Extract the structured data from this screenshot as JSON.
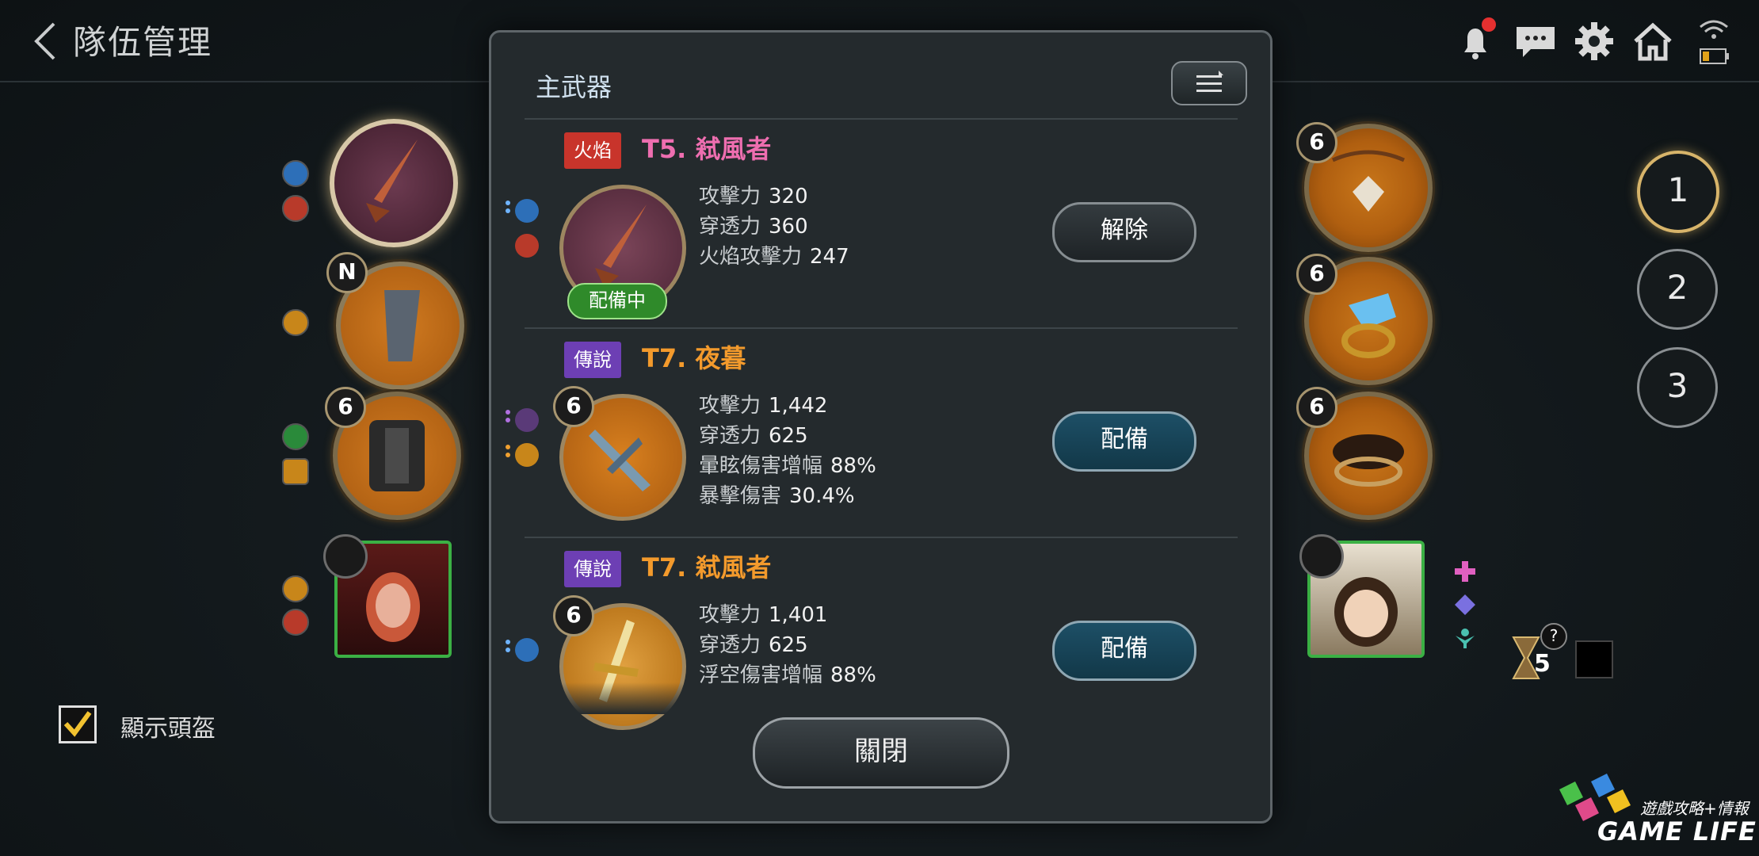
{
  "header": {
    "title": "隊伍管理",
    "icons": [
      "back-arrow-icon",
      "bell-icon",
      "chat-icon",
      "gear-icon",
      "home-icon",
      "wifi-icon",
      "battery-icon"
    ]
  },
  "team": {
    "left_gear_levels": [
      "N",
      "6"
    ],
    "right_gear_levels": [
      "6",
      "6",
      "6"
    ],
    "page_buttons": [
      "1",
      "2",
      "3"
    ],
    "active_page": "1"
  },
  "helmet_toggle": {
    "label": "顯示頭盔",
    "checked": true
  },
  "hourglass_count": "5",
  "modal": {
    "title": "主武器",
    "items": [
      {
        "tag": "火焰",
        "name": "T5. 弒風者",
        "level": "",
        "badge": "配備中",
        "stats": [
          {
            "label": "攻擊力",
            "value": "320"
          },
          {
            "label": "穿透力",
            "value": "360"
          },
          {
            "label": "火焰攻擊力",
            "value": "247"
          }
        ],
        "action": "解除"
      },
      {
        "tag": "傳說",
        "name": "T7. 夜暮",
        "level": "6",
        "stats": [
          {
            "label": "攻擊力",
            "value": "1,442"
          },
          {
            "label": "穿透力",
            "value": "625"
          },
          {
            "label": "暈眩傷害增幅",
            "value": "88%"
          },
          {
            "label": "暴擊傷害",
            "value": "30.4%"
          }
        ],
        "action": "配備"
      },
      {
        "tag": "傳說",
        "name": "T7. 弒風者",
        "level": "6",
        "stats": [
          {
            "label": "攻擊力",
            "value": "1,401"
          },
          {
            "label": "穿透力",
            "value": "625"
          },
          {
            "label": "浮空傷害增幅",
            "value": "88%"
          }
        ],
        "action": "配備"
      }
    ],
    "close_label": "關閉"
  },
  "watermark": {
    "line1": "遊戲攻略+情報",
    "line2": "GAME LIFE"
  },
  "colors": {
    "equip_button": "#1d4f66",
    "legend_tag": "#6d3fb4",
    "fire_tag": "#c8342b",
    "equipped_badge": "#2f8a2a"
  }
}
